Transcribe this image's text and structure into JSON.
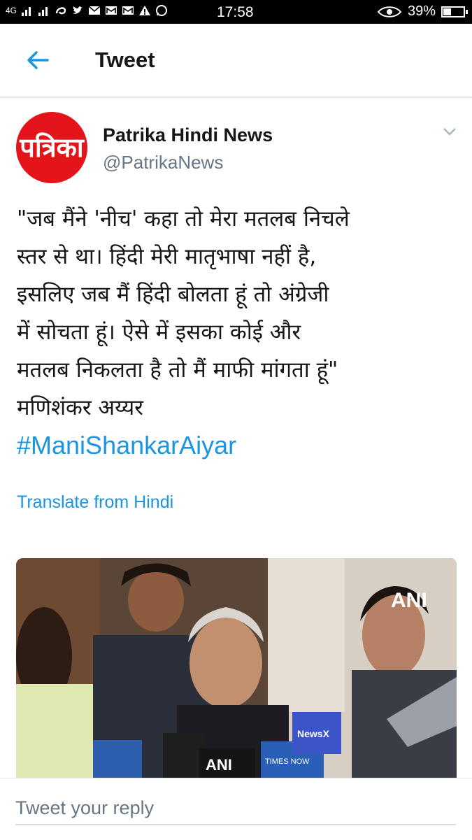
{
  "status_bar": {
    "network": "4G",
    "time": "17:58",
    "battery": "39%",
    "battery_level": 0.39
  },
  "header": {
    "title": "Tweet",
    "back_icon": "arrow-left-icon"
  },
  "tweet": {
    "avatar_text": "पत्रिका",
    "author_name": "Patrika Hindi News",
    "author_handle": "@PatrikaNews",
    "text_lines": [
      "\"जब मैंने 'नीच' कहा तो मेरा मतलब निचले",
      "स्तर से था। हिंदी मेरी मातृभाषा नहीं है,",
      "इसलिए जब मैं हिंदी बोलता हूं तो अंग्रेजी",
      "में सोचता हूं। ऐसे में इसका कोई और",
      "मतलब निकलता है तो मैं माफी मांगता हूं\"",
      "मणिशंकर अय्यर"
    ],
    "hashtag": "#ManiShankarAiyar",
    "translate_label": "Translate from Hindi",
    "media": {
      "watermark": "ANI",
      "mic_labels": [
        "ANI",
        "TIMES NOW",
        "NewsX"
      ]
    }
  },
  "reply": {
    "placeholder": "Tweet your reply"
  },
  "colors": {
    "accent": "#1b95e0",
    "text": "#14171a",
    "muted": "#657786",
    "brand_red": "#e4141b"
  }
}
